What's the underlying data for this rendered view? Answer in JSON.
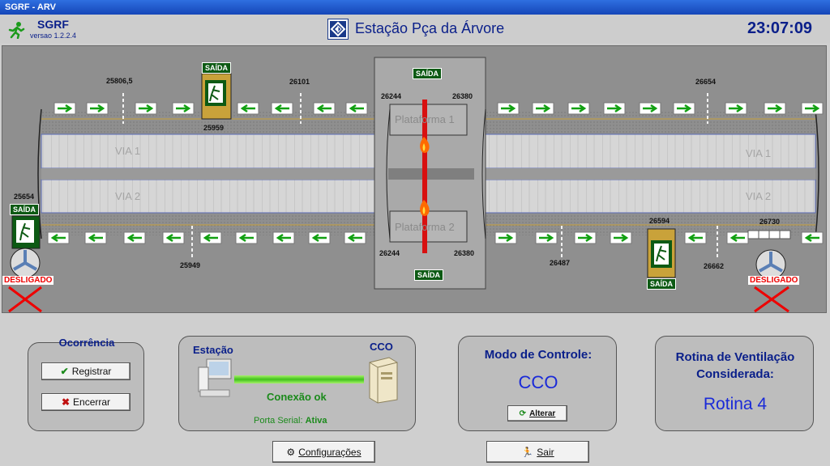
{
  "window": {
    "title": "SGRF - ARV"
  },
  "header": {
    "app_name": "SGRF",
    "app_version": "versao 1.2.2.4",
    "station_title": "Estação Pça da Árvore",
    "clock": "23:07:09"
  },
  "diagram": {
    "exit_label": "SAÍDA",
    "off_label": "DESLIGADO",
    "platform_1": "Plataforma 1",
    "platform_2": "Plataforma 2",
    "track_1": "VIA 1",
    "track_2": "VIA 2",
    "markers": {
      "m25806": "25806,5",
      "m26101": "26101",
      "m26244a": "26244",
      "m26380a": "26380",
      "m26654": "26654",
      "m25959": "25959",
      "m25654": "25654",
      "m25949": "25949",
      "m26244b": "26244",
      "m26380b": "26380",
      "m26487": "26487",
      "m26594": "26594",
      "m26730": "26730",
      "m26662": "26662"
    }
  },
  "ocorrencia": {
    "title": "Ocorrência",
    "registrar": "Registrar",
    "encerrar": "Encerrar"
  },
  "conexao": {
    "estacao": "Estação",
    "cco": "CCO",
    "status": "Conexão ok",
    "porta_label": "Porta Serial:",
    "porta_value": "Ativa"
  },
  "modo": {
    "title": "Modo de Controle:",
    "value": "CCO",
    "alterar": "Alterar"
  },
  "rotina": {
    "title_line1": "Rotina de Ventilação",
    "title_line2": "Considerada:",
    "value": "Rotina 4"
  },
  "footer": {
    "configuracoes": "Configurações",
    "sair": "Sair"
  },
  "colors": {
    "accent": "#0a1f8a",
    "exit_green": "#0d5a14",
    "fire_red": "#d81010"
  }
}
